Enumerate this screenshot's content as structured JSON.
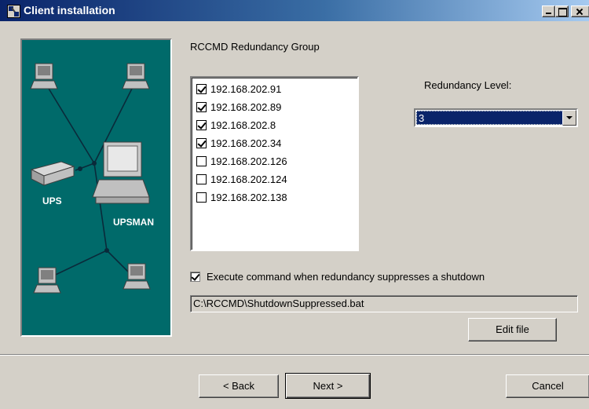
{
  "window": {
    "title": "Client installation"
  },
  "diagram": {
    "ups_label": "UPS",
    "upsman_label": "UPSMAN"
  },
  "group": {
    "title": "RCCMD Redundancy Group",
    "items": [
      {
        "ip": "192.168.202.91",
        "checked": true
      },
      {
        "ip": "192.168.202.89",
        "checked": true
      },
      {
        "ip": "192.168.202.8",
        "checked": true
      },
      {
        "ip": "192.168.202.34",
        "checked": true
      },
      {
        "ip": "192.168.202.126",
        "checked": false
      },
      {
        "ip": "192.168.202.124",
        "checked": false
      },
      {
        "ip": "192.168.202.138",
        "checked": false
      }
    ]
  },
  "redundancy": {
    "label": "Redundancy Level:",
    "value": "3"
  },
  "execute": {
    "label": "Execute command when redundancy suppresses a shutdown",
    "checked": true,
    "path": "C:\\RCCMD\\ShutdownSuppressed.bat",
    "edit_label": "Edit file"
  },
  "buttons": {
    "back": "< Back",
    "next": "Next >",
    "cancel": "Cancel"
  }
}
